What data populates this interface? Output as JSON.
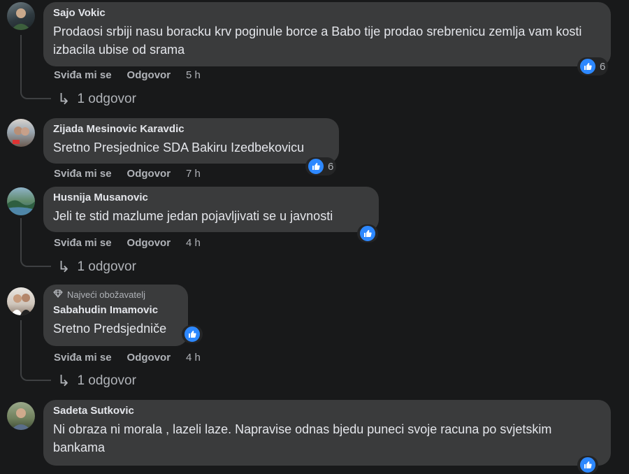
{
  "labels": {
    "like": "Sviđa mi se",
    "reply": "Odgovor"
  },
  "colors": {
    "background": "#18191a",
    "bubble": "#3a3b3c",
    "like_blue": "#2d88ff",
    "muted_text": "#b0b3b8"
  },
  "icons": {
    "reaction": "like-thumb-icon",
    "reply": "reply-arrow-icon",
    "badge": "diamond-icon"
  },
  "comments": [
    {
      "author": "Sajo Vokic",
      "text": "Prodaosi srbiji nasu boracku krv poginule borce a Babo tije prodao srebrenicu zemlja vam kosti izbacila ubise od srama",
      "time": "5 h",
      "reactions": "6",
      "replies": "1 odgovor"
    },
    {
      "author": "Zijada Mesinovic Karavdic",
      "text": "Sretno Presjednice SDA Bakiru Izedbekovicu",
      "time": "7 h",
      "reactions": "6"
    },
    {
      "author": "Husnija Musanovic",
      "text": "Jeli te stid mazlume jedan pojavljivati se u javnosti",
      "time": "4 h",
      "replies": "1 odgovor"
    },
    {
      "badge": "Najveći obožavatelj",
      "author": "Sabahudin Imamovic",
      "text": "Sretno Predsjedniče",
      "time": "4 h",
      "replies": "1 odgovor"
    },
    {
      "author": "Sadeta Sutkovic",
      "text": "Ni obraza ni morala , lazeli laze. Napravise odnas bjedu puneci svoje racuna po svjetskim bankama"
    }
  ]
}
